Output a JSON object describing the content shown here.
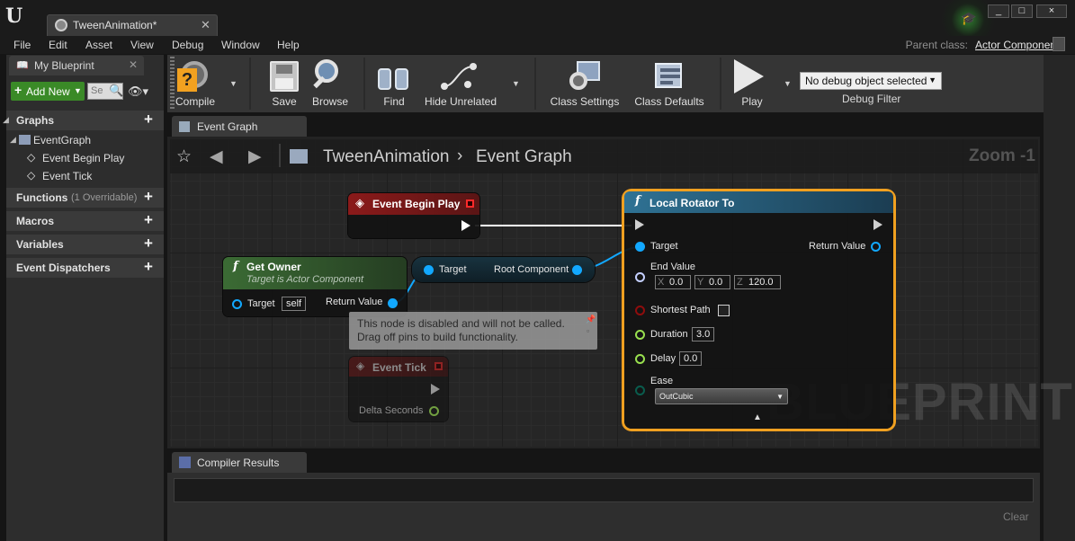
{
  "window": {
    "title_tab": "TweenAnimation*",
    "controls": [
      "_",
      "□",
      "×"
    ]
  },
  "menu": {
    "items": [
      "File",
      "Edit",
      "Asset",
      "View",
      "Debug",
      "Window",
      "Help"
    ],
    "parent_class_label": "Parent class:",
    "parent_class_value": "Actor Component"
  },
  "my_blueprint": {
    "tab_label": "My Blueprint",
    "add_new": "Add New",
    "search_placeholder": "Se",
    "sections": {
      "graphs": "Graphs",
      "functions": "Functions",
      "functions_note": "(1 Overridable)",
      "macros": "Macros",
      "variables": "Variables",
      "dispatchers": "Event Dispatchers"
    },
    "tree": {
      "event_graph": "EventGraph",
      "begin_play": "Event Begin Play",
      "tick": "Event Tick"
    }
  },
  "toolbar": {
    "compile": "Compile",
    "save": "Save",
    "browse": "Browse",
    "find": "Find",
    "hide_unrelated": "Hide Unrelated",
    "class_settings": "Class Settings",
    "class_defaults": "Class Defaults",
    "play": "Play",
    "debug_object": "No debug object selected",
    "debug_filter": "Debug Filter"
  },
  "graph": {
    "tab_label": "Event Graph",
    "breadcrumb": [
      "TweenAnimation",
      "Event Graph"
    ],
    "zoom": "Zoom -1",
    "watermark": "BLUEPRINT",
    "nodes": {
      "begin_play": {
        "title": "Event Begin Play"
      },
      "get_owner": {
        "title": "Get Owner",
        "subtitle": "Target is Actor Component",
        "target_label": "Target",
        "target_value": "self",
        "return_label": "Return Value"
      },
      "root_component": {
        "target_label": "Target",
        "output_label": "Root Component"
      },
      "local_rotator": {
        "title": "Local Rotator To",
        "target_label": "Target",
        "return_label": "Return Value",
        "end_value_label": "End Value",
        "x_label": "X",
        "x": "0.0",
        "y_label": "Y",
        "y": "0.0",
        "z_label": "Z",
        "z": "120.0",
        "shortest_path_label": "Shortest Path",
        "shortest_path_checked": false,
        "duration_label": "Duration",
        "duration": "3.0",
        "delay_label": "Delay",
        "delay": "0.0",
        "ease_label": "Ease",
        "ease": "OutCubic"
      },
      "tick": {
        "title": "Event Tick",
        "delta_label": "Delta Seconds"
      }
    },
    "disabled_tooltip": [
      "This node is disabled and will not be called.",
      "Drag off pins to build functionality."
    ]
  },
  "compiler": {
    "tab_label": "Compiler Results",
    "clear": "Clear"
  },
  "colors": {
    "event_header": "#8b1a1a",
    "function_header": "#2a6b8c",
    "pure_header": "#3a6b34",
    "selection": "#f0a020",
    "object_pin": "#12a8ff"
  }
}
